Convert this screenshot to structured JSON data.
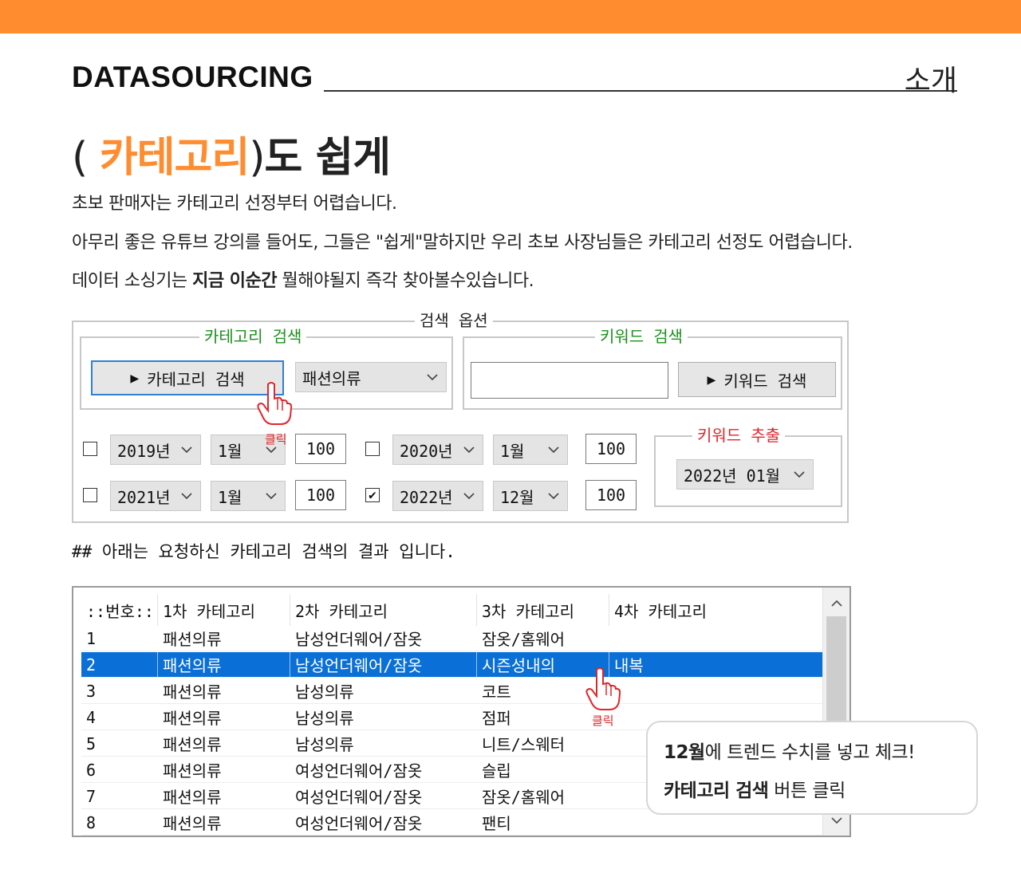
{
  "header": {
    "brand": "DATASOURCING",
    "section": "소개"
  },
  "headline": {
    "paren_open": "( ",
    "accent": "카테고리",
    "paren_close": ")",
    "rest": "도 쉽게"
  },
  "description": {
    "line1": "초보 판매자는 카테고리 선정부터 어렵습니다.",
    "line2": "아무리 좋은 유튜브 강의를 들어도, 그들은 \"쉽게\"말하지만 우리 초보 사장님들은 카테고리 선정도 어렵습니다.",
    "line3_pre": "데이터 소싱기는 ",
    "line3_bold": "지금 이순간",
    "line3_post": " 뭘해야될지 즉각 찾아볼수있습니다."
  },
  "search_options": {
    "title": "검색 옵션",
    "category_group": {
      "title": "카테고리 검색",
      "button": "카테고리 검색",
      "selected_category": "패션의류"
    },
    "keyword_group": {
      "title": "키워드 검색",
      "input_value": "",
      "button": "키워드 검색"
    },
    "periods": [
      {
        "checked": false,
        "year": "2019년",
        "month": "1월",
        "count": "100"
      },
      {
        "checked": false,
        "year": "2020년",
        "month": "1월",
        "count": "100"
      },
      {
        "checked": false,
        "year": "2021년",
        "month": "1월",
        "count": "100"
      },
      {
        "checked": true,
        "checkmark": "✔",
        "year": "2022년",
        "month": "12월",
        "count": "100"
      }
    ],
    "keyword_extract": {
      "title": "키워드 추출",
      "selected": "2022년 01월"
    },
    "click_label": "클릭"
  },
  "results": {
    "caption": "## 아래는 요청하신 카테고리 검색의 결과 입니다.",
    "columns": [
      "::번호::",
      "1차 카테고리",
      "2차 카테고리",
      "3차 카테고리",
      "4차 카테고리"
    ],
    "rows": [
      [
        "1",
        "패션의류",
        "남성언더웨어/잠옷",
        "잠옷/홈웨어",
        ""
      ],
      [
        "2",
        "패션의류",
        "남성언더웨어/잠옷",
        "시즌성내의",
        "내복"
      ],
      [
        "3",
        "패션의류",
        "남성의류",
        "코트",
        ""
      ],
      [
        "4",
        "패션의류",
        "남성의류",
        "점퍼",
        ""
      ],
      [
        "5",
        "패션의류",
        "남성의류",
        "니트/스웨터",
        ""
      ],
      [
        "6",
        "패션의류",
        "여성언더웨어/잠옷",
        "슬립",
        ""
      ],
      [
        "7",
        "패션의류",
        "여성언더웨어/잠옷",
        "잠옷/홈웨어",
        ""
      ],
      [
        "8",
        "패션의류",
        "여성언더웨어/잠옷",
        "팬티",
        ""
      ]
    ],
    "selected_row": 2,
    "click_label": "클릭"
  },
  "callout": {
    "line1_bold": "12월",
    "line1_rest": "에 트렌드 수치를 넣고 체크!",
    "line2_bold": "카테고리 검색",
    "line2_rest": " 버튼 클릭"
  },
  "colors": {
    "accent": "#ff8c2e",
    "group_title_green": "#1a8f1a",
    "group_title_red": "#e0262a",
    "selection_blue": "#0a6fd6"
  }
}
